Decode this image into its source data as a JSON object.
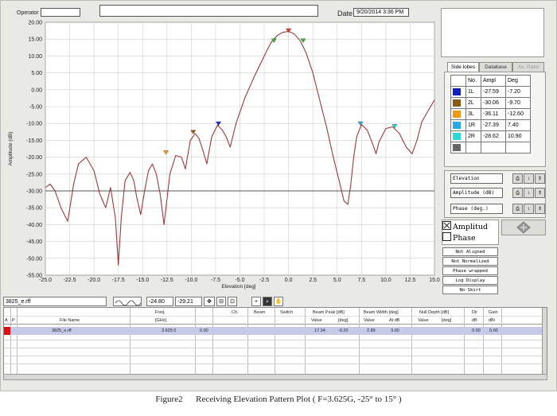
{
  "header": {
    "operator_label": "Operator",
    "operator_value": "",
    "comment_value": "",
    "date_label": "Date",
    "date_value": "9/20/2014 3:36 PM"
  },
  "chart_data": {
    "type": "line",
    "xlabel": "Elevation [deg]",
    "ylabel": "Amplitude (dB)",
    "xlim": [
      -25,
      15
    ],
    "ylim": [
      -55,
      20
    ],
    "x_ticks": [
      "-25.0",
      "-22.5",
      "-20.0",
      "-17.5",
      "-15.0",
      "-12.5",
      "-10.0",
      "-7.5",
      "-5.0",
      "-2.5",
      "0.0",
      "2.5",
      "5.0",
      "7.5",
      "10.0",
      "12.5",
      "15.0"
    ],
    "y_ticks": [
      "20.00",
      "15.00",
      "10.00",
      "5.00",
      "0.00",
      "-5.00",
      "-10.00",
      "-15.00",
      "-20.00",
      "-25.00",
      "-30.00",
      "-35.00",
      "-40.00",
      "-45.00",
      "-50.00",
      "-55.00"
    ],
    "reference_level": -30,
    "grid": true,
    "series": [
      {
        "color": "#9b3a3a",
        "x": [
          -25.0,
          -24.5,
          -24.0,
          -23.4,
          -22.7,
          -22.1,
          -21.6,
          -20.8,
          -20.0,
          -19.4,
          -18.8,
          -18.3,
          -17.8,
          -17.5,
          -17.2,
          -16.8,
          -16.3,
          -15.9,
          -15.6,
          -15.2,
          -14.8,
          -14.4,
          -14.0,
          -13.6,
          -13.2,
          -12.8,
          -12.2,
          -11.6,
          -11.0,
          -10.6,
          -10.1,
          -9.6,
          -9.2,
          -8.8,
          -8.4,
          -7.9,
          -7.3,
          -6.8,
          -6.4,
          -6.0,
          -5.4,
          -4.5,
          -3.5,
          -2.5,
          -1.8,
          -1.2,
          -0.6,
          0.0,
          0.6,
          1.2,
          1.8,
          2.5,
          3.2,
          3.9,
          4.6,
          5.2,
          5.7,
          6.1,
          6.4,
          6.7,
          7.0,
          7.5,
          8.1,
          8.7,
          9.0,
          9.3,
          10.0,
          10.7,
          11.4,
          12.1,
          12.7,
          13.2,
          13.7,
          14.3,
          15.0
        ],
        "values": [
          -29.0,
          -28.0,
          -30.0,
          -35.0,
          -39.0,
          -28.0,
          -22.0,
          -20.0,
          -24.0,
          -31.0,
          -35.0,
          -29.0,
          -38.0,
          -52.0,
          -38.0,
          -27.0,
          -24.5,
          -27.0,
          -32.0,
          -37.0,
          -30.0,
          -24.0,
          -22.0,
          -25.0,
          -31.0,
          -40.0,
          -25.0,
          -19.5,
          -20.0,
          -23.5,
          -15.0,
          -13.0,
          -14.5,
          -18.0,
          -22.0,
          -14.0,
          -10.5,
          -12.0,
          -14.0,
          -17.0,
          -10.0,
          -2.5,
          4.0,
          10.0,
          14.0,
          16.0,
          17.0,
          17.3,
          16.5,
          14.5,
          11.0,
          5.0,
          -3.0,
          -11.0,
          -20.0,
          -27.0,
          -33.0,
          -34.0,
          -28.0,
          -20.0,
          -14.0,
          -10.3,
          -12.0,
          -16.5,
          -19.0,
          -15.5,
          -11.5,
          -11.0,
          -13.0,
          -17.0,
          -19.0,
          -15.0,
          -9.5,
          -6.5,
          -3.0
        ]
      }
    ],
    "markers": [
      {
        "name": "main",
        "x": 0.0,
        "y": 17.3,
        "color": "#e03a2a"
      },
      {
        "name": "half-left",
        "x": -1.5,
        "y": 14.3,
        "color": "#3fae3f"
      },
      {
        "name": "half-right",
        "x": 1.5,
        "y": 14.3,
        "color": "#3fae3f"
      },
      {
        "name": "1L",
        "x": -7.2,
        "y": -10.3,
        "color": "#1f2ccc"
      },
      {
        "name": "2L",
        "x": -9.8,
        "y": -12.8,
        "color": "#9a5b12"
      },
      {
        "name": "3L",
        "x": -12.6,
        "y": -18.9,
        "color": "#ee9a1a"
      },
      {
        "name": "1R",
        "x": 7.4,
        "y": -10.3,
        "color": "#28a9e6"
      },
      {
        "name": "2R",
        "x": 10.9,
        "y": -11.1,
        "color": "#20d6d6"
      }
    ]
  },
  "side_panel": {
    "tabs": [
      "Side lobes",
      "Database",
      "Ax. Ratio"
    ],
    "table_headers": [
      "",
      "No.",
      "Ampl",
      "Deg"
    ],
    "rows": [
      {
        "color": "#1020c0",
        "no": "1L",
        "ampl": "-27.59",
        "deg": "-7.20"
      },
      {
        "color": "#8c5a14",
        "no": "2L",
        "ampl": "-30.06",
        "deg": "-9.70"
      },
      {
        "color": "#f09a14",
        "no": "3L",
        "ampl": "-36.11",
        "deg": "-12.60"
      },
      {
        "color": "#28a8e8",
        "no": "1R",
        "ampl": "-27.39",
        "deg": "7.40"
      },
      {
        "color": "#28dada",
        "no": "2R",
        "ampl": "-28.62",
        "deg": "10.90"
      },
      {
        "color": "#666666",
        "no": "",
        "ampl": "",
        "deg": ""
      }
    ],
    "controls": [
      "Elevation",
      "Amplitude (dB)",
      "Phase (deg.)"
    ],
    "mode_checks": [
      {
        "label": "Amplitud",
        "checked": true
      },
      {
        "label": "Phase",
        "checked": false
      }
    ],
    "options": [
      "Not Aligned",
      "Not Normalized",
      "Phase wrapped",
      "Log Display",
      "No Skirt"
    ]
  },
  "toolbar": {
    "file_name": "3825_e.rff",
    "cursor_x": "-24.80",
    "cursor_y": "-29.21"
  },
  "grid_table": {
    "headers": {
      "a": "A",
      "p": "P",
      "file_name": "File Name",
      "freq": "Freq.",
      "freq_unit": "[GHz]",
      "ch": "Ch.",
      "beam": "Beam",
      "switch": "Switch",
      "beam_peak": "Beam Peak [dB]",
      "bp_value": "Value",
      "bp_deg": "[deg]",
      "beam_width": "Beam Width [deg]",
      "bw_value": "Value",
      "bw_at": "At dB",
      "null_depth": "Null Depth [dB]",
      "nd_value": "Value",
      "nd_deg": "[deg]",
      "dir": "Dir",
      "dir_unit": "dB",
      "gain": "Gain",
      "gain_unit": "dBi"
    },
    "row": {
      "file_name": "3825_e.rff",
      "freq": "3.625 0",
      "ch_val": "0.00",
      "bp_value": "17.34",
      "bp_deg": "-0.20",
      "bw_value": "2.89",
      "bw_at": "3.00",
      "dir": "0.00",
      "gain": "0.00"
    }
  },
  "caption": {
    "figure": "Figure2",
    "text": "Receiving Elevation Pattern Plot ( F=3.625G, -25° to 15° )"
  }
}
